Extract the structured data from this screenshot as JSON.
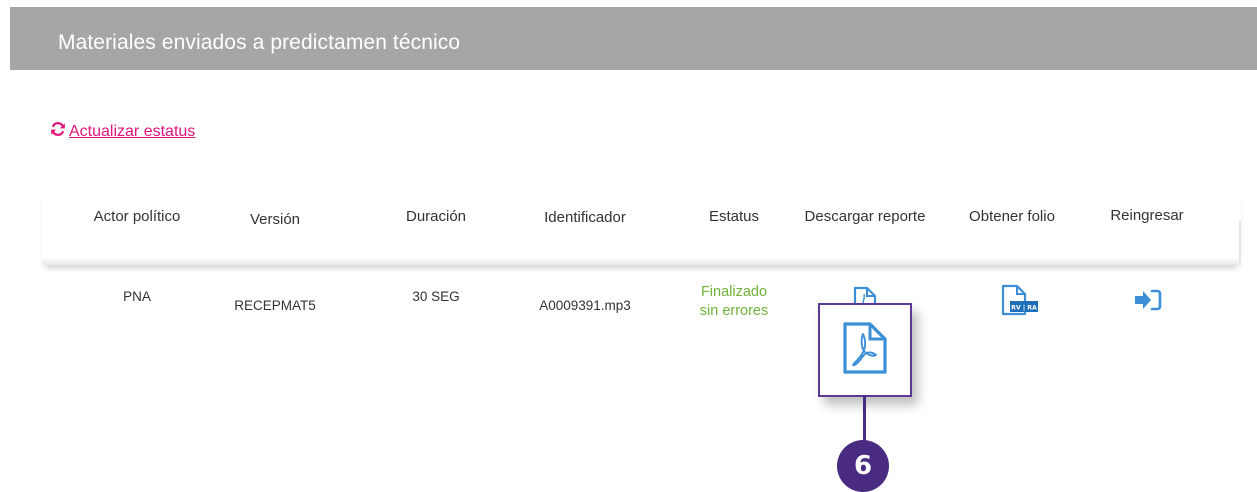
{
  "header": {
    "title": "Materiales enviados a predictamen técnico"
  },
  "refresh": {
    "label": "Actualizar estatus",
    "icon": "refresh-icon"
  },
  "table": {
    "columns": [
      "Actor político",
      "Versión",
      "Duración",
      "Identificador",
      "Estatus",
      "Descargar reporte",
      "Obtener folio",
      "Reingresar"
    ],
    "rows": [
      {
        "actor": "PNA",
        "version": "RECEPMAT5",
        "duracion": "30 SEG",
        "identificador": "A0009391.mp3",
        "estatus_line1": "Finalizado",
        "estatus_line2": "sin errores",
        "descargar_icon": "pdf-file-icon",
        "folio_icon": "folio-document-icon",
        "folio_badge": "RV | RA",
        "reingresar_icon": "sign-in-arrow-icon"
      }
    ]
  },
  "callout": {
    "number": "6"
  },
  "colors": {
    "accent": "#e0147b",
    "status_ok": "#6fb33a",
    "icon_blue": "#3a8fd6",
    "callout": "#4a2b82",
    "header_bg": "#a6a6a6"
  }
}
